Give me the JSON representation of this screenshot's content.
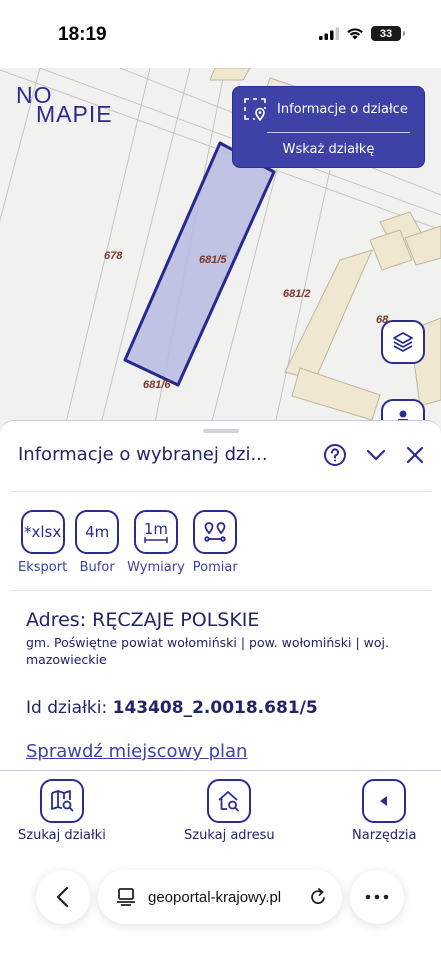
{
  "status_bar": {
    "time": "18:19",
    "battery": "33"
  },
  "map": {
    "logo_line1": "NO",
    "logo_line2": "MAPIE",
    "parcel_labels": [
      "678",
      "681/5",
      "681/2",
      "681/6",
      "68"
    ],
    "info_card": {
      "parcel_info": "Informacje o działce",
      "show_parcel": "Wskaż działkę"
    },
    "selected_parcel_fill": "#b9bbe2",
    "selected_parcel_stroke": "#26298f",
    "layers_icon": "layers-icon",
    "person_icon": "person-icon"
  },
  "panel": {
    "title": "Informacje o wybranej dzi...",
    "tools": [
      {
        "box": "*xlsx",
        "label": "Eksport"
      },
      {
        "box": "4m",
        "label": "Bufor"
      },
      {
        "box": "1m",
        "label": "Wymiary"
      },
      {
        "box": "",
        "label": "Pomiar"
      }
    ],
    "address": "Adres: RĘCZAJE POLSKIE",
    "address_detail": "gm. Poświętne powiat wołomiński | pow. wołomiński | woj. mazowieckie",
    "parcel_id_label": "Id działki:",
    "parcel_id_value": "143408_2.0018.681/5",
    "plan_link": "Sprawdź miejscowy plan"
  },
  "bottom_nav": [
    {
      "label": "Szukaj działki",
      "icon": "map-search-icon"
    },
    {
      "label": "Szukaj adresu",
      "icon": "house-search-icon"
    },
    {
      "label": "Narzędzia",
      "icon": "triangle-left-icon"
    }
  ],
  "browser": {
    "url": "geoportal-krajowy.pl"
  },
  "colors": {
    "brand": "#2b2c8f",
    "card": "#3e42a7",
    "text": "#23236b"
  }
}
